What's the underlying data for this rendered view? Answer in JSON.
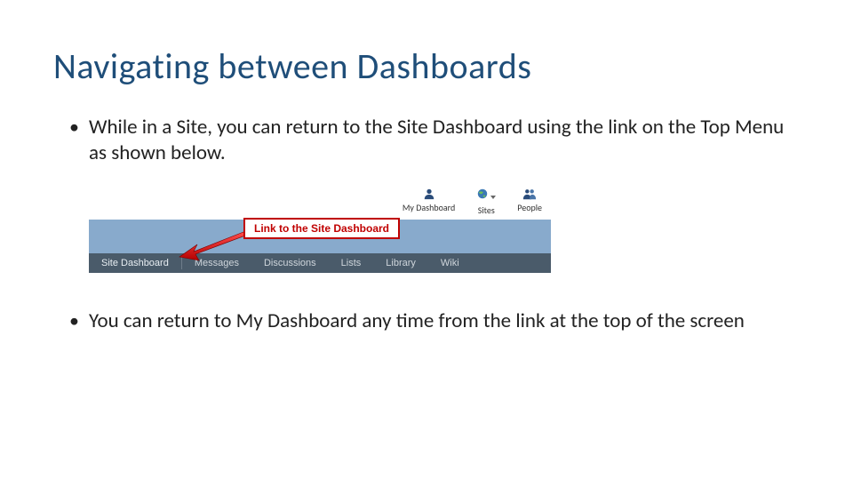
{
  "title": "Navigating between Dashboards",
  "bullet1": "While in a Site, you can return to the Site Dashboard using the link on the Top Menu as shown below.",
  "bullet2": "You can return to My Dashboard any time from the link at the top of the screen",
  "figure": {
    "topnav": {
      "my_dashboard": "My Dashboard",
      "sites": "Sites",
      "people": "People"
    },
    "callout": "Link to the Site Dashboard",
    "tabs": {
      "site_dashboard": "Site Dashboard",
      "messages": "Messages",
      "discussions": "Discussions",
      "lists": "Lists",
      "library": "Library",
      "wiki": "Wiki"
    }
  }
}
